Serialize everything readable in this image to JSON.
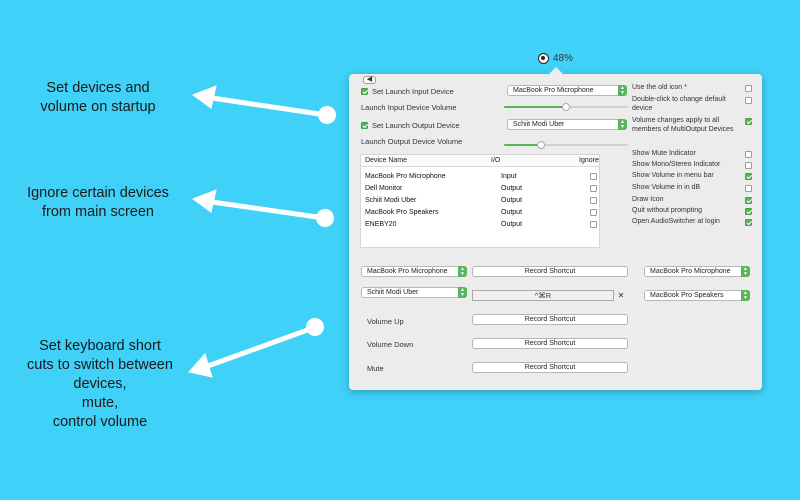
{
  "annotations": [
    {
      "lines": [
        "Set devices and",
        "volume on startup"
      ]
    },
    {
      "lines": [
        "Ignore certain devices",
        "from main screen"
      ]
    },
    {
      "lines": [
        "Set keyboard short",
        "cuts to switch between",
        "devices,",
        "mute,",
        "control volume"
      ]
    }
  ],
  "status": {
    "volume_text": "48%"
  },
  "startup": {
    "set_input_label": "Set Launch Input Device",
    "set_input_checked": true,
    "input_device": "MacBook Pro Microphone",
    "input_volume_label": "Launch Input Device Volume",
    "input_volume": 0.5,
    "set_output_label": "Set Launch Output Device",
    "set_output_checked": true,
    "output_device": "Schiit Modi Uber",
    "output_volume_label": "Launch Output Device Volume",
    "output_volume": 0.3
  },
  "devices": {
    "headers": [
      "Device Name",
      "I/O",
      "Ignore"
    ],
    "rows": [
      {
        "name": "MacBook Pro Microphone",
        "io": "Input",
        "ignore": false
      },
      {
        "name": "Dell Monitor",
        "io": "Output",
        "ignore": false
      },
      {
        "name": "Schiit Modi Uber",
        "io": "Output",
        "ignore": false
      },
      {
        "name": "MacBook Pro Speakers",
        "io": "Output",
        "ignore": false
      },
      {
        "name": "ENEBY20",
        "io": "Output",
        "ignore": false
      }
    ]
  },
  "options": [
    {
      "label": "Use the old icon *",
      "checked": false
    },
    {
      "label": "Double-click to change default device",
      "checked": false
    },
    {
      "label": "Volume changes apply to all members of MultiOutput Devices",
      "checked": true
    },
    {
      "label": "Show Mute Indicator",
      "checked": false
    },
    {
      "label": "Show Mono/Stereo Indicator",
      "checked": false
    },
    {
      "label": "Show Volume in menu bar",
      "checked": true
    },
    {
      "label": "Show Volume in in dB",
      "checked": false
    },
    {
      "label": "Draw Icon",
      "checked": true
    },
    {
      "label": "Quit without prompting",
      "checked": true
    },
    {
      "label": "Open AudioSwitcher at login",
      "checked": true
    }
  ],
  "shortcuts": {
    "device1": "MacBook Pro Microphone",
    "device1_button": "Record Shortcut",
    "device1_right": "MacBook Pro Microphone",
    "device2": "Schiit Modi Uber",
    "device2_shortcut": "^⌘R",
    "device2_clear": "✕",
    "device2_right": "MacBook Pro Speakers",
    "volume_up_label": "Volume Up",
    "volume_up_button": "Record Shortcut",
    "volume_down_label": "Volume Down",
    "volume_down_button": "Record Shortcut",
    "mute_label": "Mute",
    "mute_button": "Record Shortcut"
  },
  "colors": {
    "background": "#3fd1f8",
    "accent": "#5ab45a",
    "arrow": "#ffffff"
  }
}
